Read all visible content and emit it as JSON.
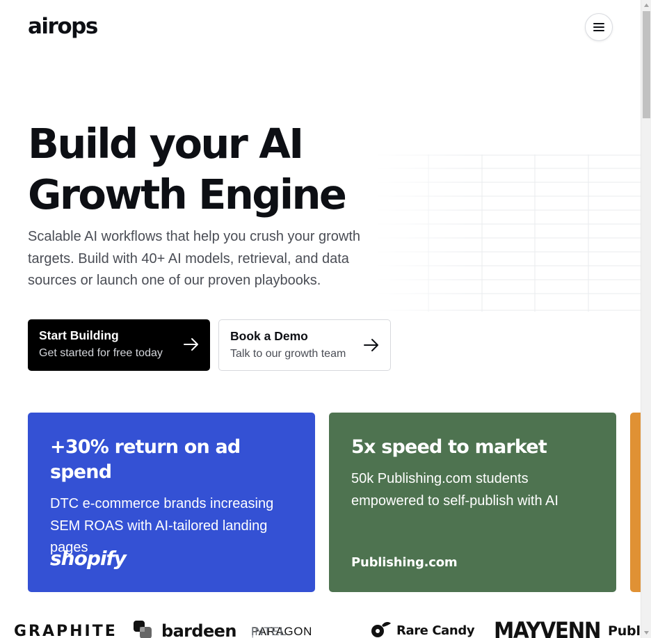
{
  "header": {
    "logo_text": "airops",
    "menu_icon": "hamburger-menu-icon"
  },
  "hero": {
    "title_line1": "Build your AI",
    "title_line2": "Growth Engine",
    "subtitle": "Scalable AI workflows that help you crush your growth targets. Build with 40+ AI models, retrieval, and data sources or launch one of our proven playbooks.",
    "primary_cta": {
      "title": "Start Building",
      "subtitle": "Get started for free today",
      "icon": "arrow-right-icon"
    },
    "secondary_cta": {
      "title": "Book a Demo",
      "subtitle": "Talk to our growth team",
      "icon": "arrow-right-icon"
    }
  },
  "cards": [
    {
      "stat": "+30% return on ad spend",
      "description": "DTC e-commerce brands increasing SEM ROAS with AI-tailored landing pages",
      "brand": "shopify",
      "color": "#3451d4"
    },
    {
      "stat": "5x speed to market",
      "description": "50k Publishing.com students empowered to self-publish with AI",
      "brand": "Publishing.com",
      "color": "#4e7350"
    },
    {
      "color": "#e09134"
    }
  ],
  "logo_strip": {
    "graphite": "GRAPHITE",
    "bardeen": "bardeen",
    "paragon": "PARAGON",
    "paragon_sep": "|",
    "paragon_intel": "INTEL",
    "rare_candy": "Rare Candy",
    "mayvenn": "MAYVENN",
    "publishing": "Publis"
  },
  "colors": {
    "text": "#0d0f14",
    "muted": "#4a4d55",
    "primary_button": "#000000"
  }
}
